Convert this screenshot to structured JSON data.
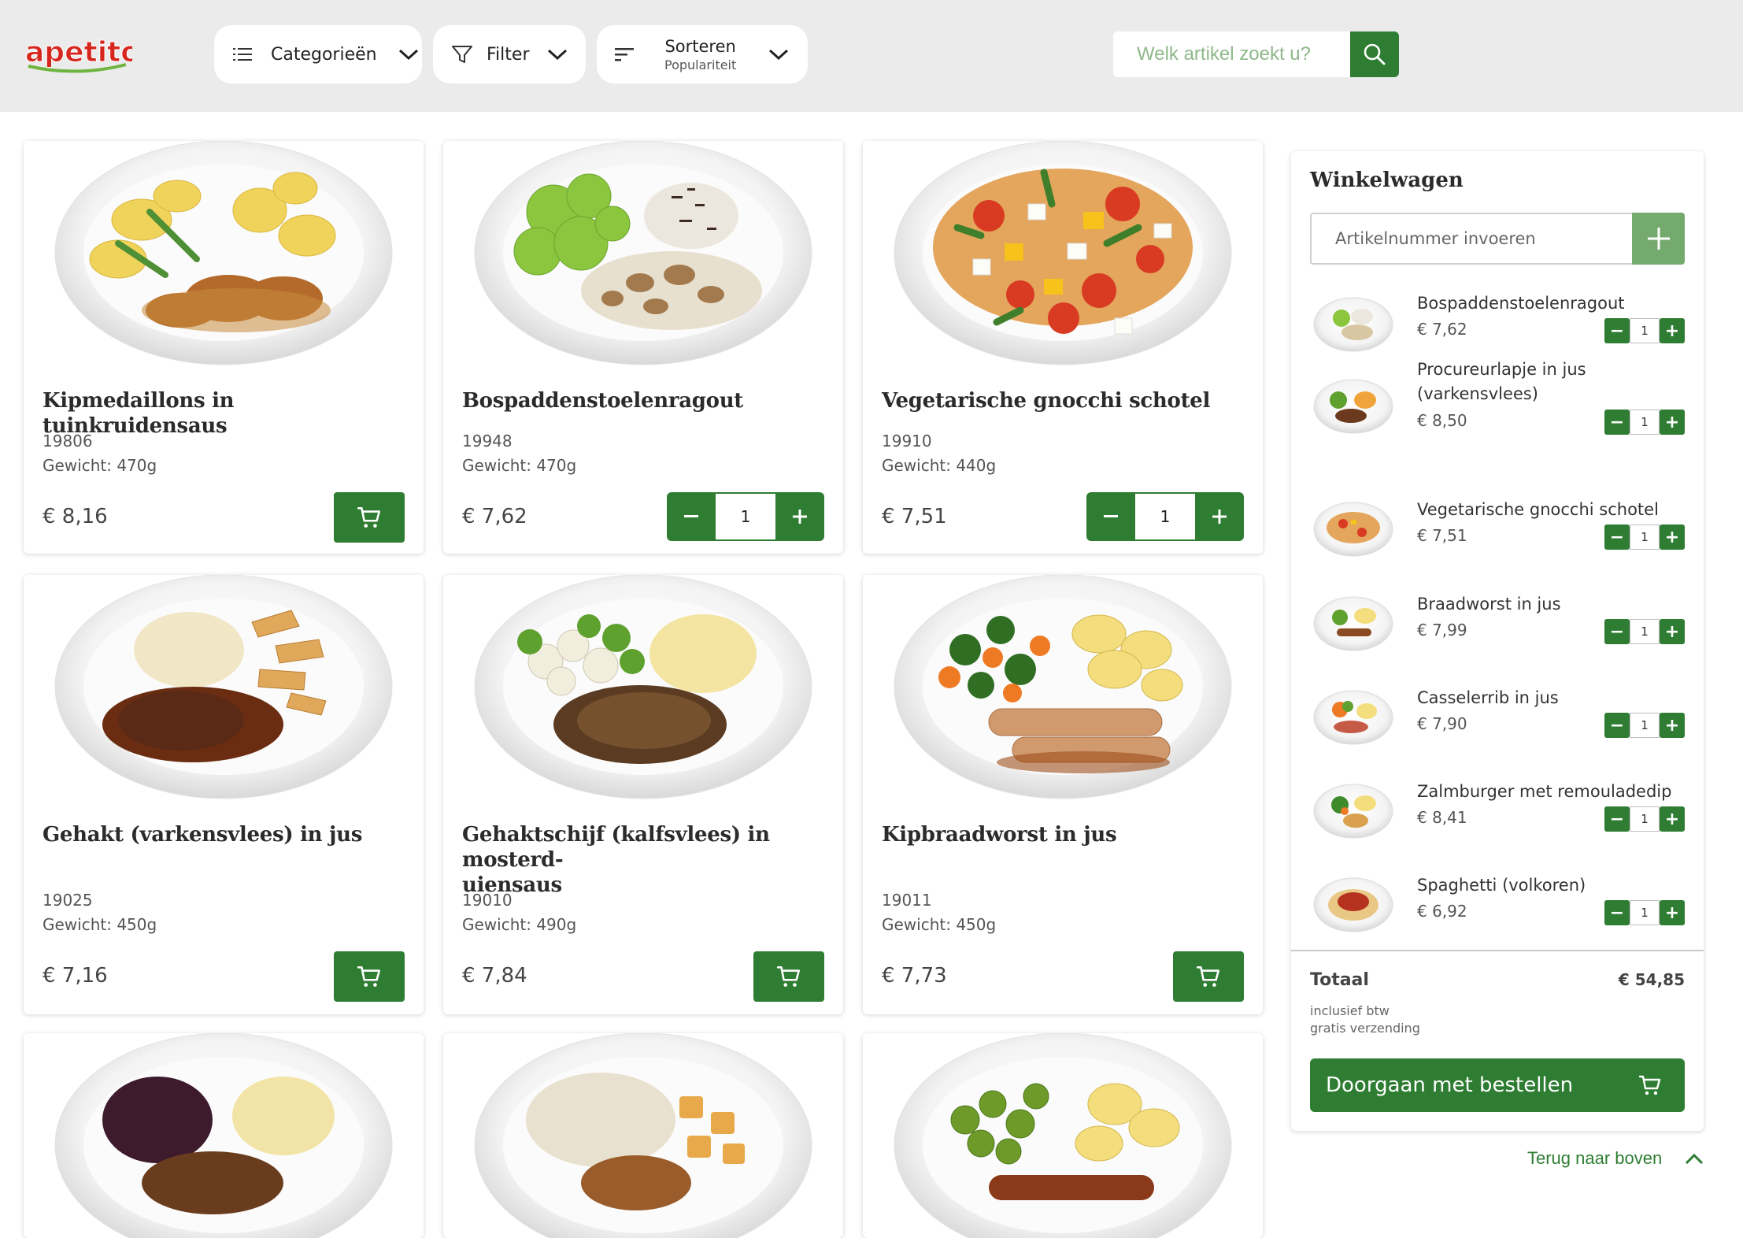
{
  "header": {
    "logo_text": "apetito",
    "categories_label": "Categorieën",
    "filter_label": "Filter",
    "sort_label": "Sorteren",
    "sort_value": "Populariteit",
    "search_placeholder": "Welk artikel zoekt u?"
  },
  "products": [
    {
      "name": "Kipmedaillons in tuinkruidensaus",
      "code": "19806",
      "weight": "Gewicht: 470g",
      "price": "€ 8,16",
      "in_cart": false
    },
    {
      "name": "Bospaddenstoelenragout",
      "code": "19948",
      "weight": "Gewicht: 470g",
      "price": "€ 7,62",
      "in_cart": true,
      "qty": "1"
    },
    {
      "name": "Vegetarische gnocchi schotel",
      "code": "19910",
      "weight": "Gewicht: 440g",
      "price": "€ 7,51",
      "in_cart": true,
      "qty": "1"
    },
    {
      "name": "Gehakt (varkensvlees) in jus",
      "code": "19025",
      "weight": "Gewicht: 450g",
      "price": "€ 7,16",
      "in_cart": false
    },
    {
      "name": "Gehaktschijf (kalfsvlees) in mosterd-uiensaus",
      "name_line1": "Gehaktschijf (kalfsvlees) in mosterd-",
      "name_line2": "uiensaus",
      "code": "19010",
      "weight": "Gewicht: 490g",
      "price": "€ 7,84",
      "in_cart": false
    },
    {
      "name": "Kipbraadworst in jus",
      "code": "19011",
      "weight": "Gewicht: 450g",
      "price": "€ 7,73",
      "in_cart": false
    }
  ],
  "cart": {
    "title": "Winkelwagen",
    "article_placeholder": "Artikelnummer invoeren",
    "items": [
      {
        "name": "Bospaddenstoelenragout",
        "price": "€ 7,62",
        "qty": "1"
      },
      {
        "name": "Procureurlapje in jus (varkensvlees)",
        "name_line1": "Procureurlapje in jus",
        "name_line2": "(varkensvlees)",
        "price": "€ 8,50",
        "qty": "1"
      },
      {
        "name": "Vegetarische gnocchi schotel",
        "price": "€ 7,51",
        "qty": "1"
      },
      {
        "name": "Braadworst in jus",
        "price": "€ 7,99",
        "qty": "1"
      },
      {
        "name": "Casselerrib in jus",
        "price": "€ 7,90",
        "qty": "1"
      },
      {
        "name": "Zalmburger met remouladedip",
        "price": "€ 8,41",
        "qty": "1"
      },
      {
        "name": "Spaghetti (volkoren)",
        "price": "€ 6,92",
        "qty": "1"
      }
    ],
    "total_label": "Totaal",
    "total_value": "€ 54,85",
    "note_vat": "inclusief btw",
    "note_shipping": "gratis verzending",
    "checkout_label": "Doorgaan met bestellen"
  },
  "back_to_top": "Terug naar boven",
  "colors": {
    "brand_green": "#2e7d32",
    "light_green": "#74aa6e",
    "header_bg": "#ebebeb",
    "logo_red": "#d7261e"
  }
}
